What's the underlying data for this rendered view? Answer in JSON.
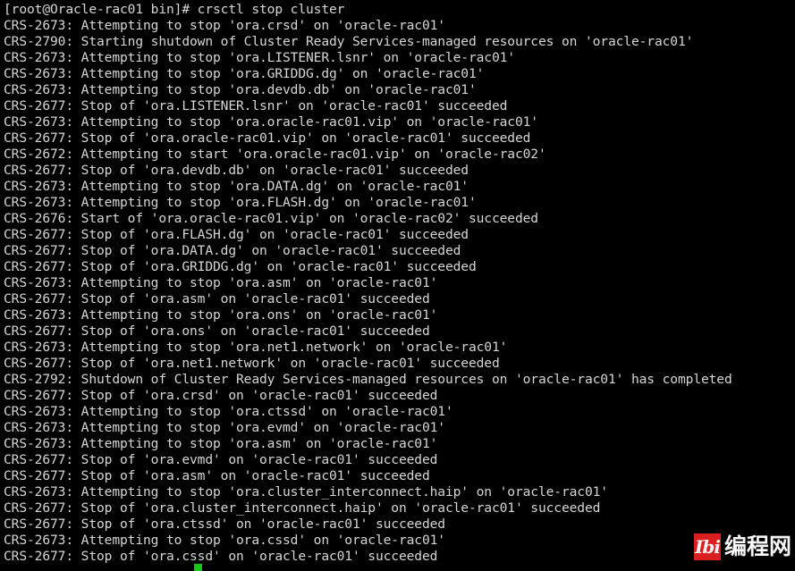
{
  "terminal": {
    "prompt_line": "[root@Oracle-rac01 bin]# crsctl stop cluster",
    "colors": {
      "background": "#000000",
      "foreground": "#d6d6d6",
      "cursor": "#19c319"
    },
    "cursor": {
      "visible": true,
      "column": 25,
      "row": 36
    },
    "lines": [
      "[root@Oracle-rac01 bin]# crsctl stop cluster",
      "CRS-2673: Attempting to stop 'ora.crsd' on 'oracle-rac01'",
      "CRS-2790: Starting shutdown of Cluster Ready Services-managed resources on 'oracle-rac01'",
      "CRS-2673: Attempting to stop 'ora.LISTENER.lsnr' on 'oracle-rac01'",
      "CRS-2673: Attempting to stop 'ora.GRIDDG.dg' on 'oracle-rac01'",
      "CRS-2673: Attempting to stop 'ora.devdb.db' on 'oracle-rac01'",
      "CRS-2677: Stop of 'ora.LISTENER.lsnr' on 'oracle-rac01' succeeded",
      "CRS-2673: Attempting to stop 'ora.oracle-rac01.vip' on 'oracle-rac01'",
      "CRS-2677: Stop of 'ora.oracle-rac01.vip' on 'oracle-rac01' succeeded",
      "CRS-2672: Attempting to start 'ora.oracle-rac01.vip' on 'oracle-rac02'",
      "CRS-2677: Stop of 'ora.devdb.db' on 'oracle-rac01' succeeded",
      "CRS-2673: Attempting to stop 'ora.DATA.dg' on 'oracle-rac01'",
      "CRS-2673: Attempting to stop 'ora.FLASH.dg' on 'oracle-rac01'",
      "CRS-2676: Start of 'ora.oracle-rac01.vip' on 'oracle-rac02' succeeded",
      "CRS-2677: Stop of 'ora.FLASH.dg' on 'oracle-rac01' succeeded",
      "CRS-2677: Stop of 'ora.DATA.dg' on 'oracle-rac01' succeeded",
      "CRS-2677: Stop of 'ora.GRIDDG.dg' on 'oracle-rac01' succeeded",
      "CRS-2673: Attempting to stop 'ora.asm' on 'oracle-rac01'",
      "CRS-2677: Stop of 'ora.asm' on 'oracle-rac01' succeeded",
      "CRS-2673: Attempting to stop 'ora.ons' on 'oracle-rac01'",
      "CRS-2677: Stop of 'ora.ons' on 'oracle-rac01' succeeded",
      "CRS-2673: Attempting to stop 'ora.net1.network' on 'oracle-rac01'",
      "CRS-2677: Stop of 'ora.net1.network' on 'oracle-rac01' succeeded",
      "CRS-2792: Shutdown of Cluster Ready Services-managed resources on 'oracle-rac01' has completed",
      "CRS-2677: Stop of 'ora.crsd' on 'oracle-rac01' succeeded",
      "CRS-2673: Attempting to stop 'ora.ctssd' on 'oracle-rac01'",
      "CRS-2673: Attempting to stop 'ora.evmd' on 'oracle-rac01'",
      "CRS-2673: Attempting to stop 'ora.asm' on 'oracle-rac01'",
      "CRS-2677: Stop of 'ora.evmd' on 'oracle-rac01' succeeded",
      "CRS-2677: Stop of 'ora.asm' on 'oracle-rac01' succeeded",
      "CRS-2673: Attempting to stop 'ora.cluster_interconnect.haip' on 'oracle-rac01'",
      "CRS-2677: Stop of 'ora.cluster_interconnect.haip' on 'oracle-rac01' succeeded",
      "CRS-2677: Stop of 'ora.ctssd' on 'oracle-rac01' succeeded",
      "CRS-2673: Attempting to stop 'ora.cssd' on 'oracle-rac01'",
      "CRS-2677: Stop of 'ora.cssd' on 'oracle-rac01' succeeded"
    ]
  },
  "watermark": {
    "logo_text": "Ibi",
    "text": "编程网",
    "logo_color": "#e02020",
    "text_color": "#ffffff"
  }
}
